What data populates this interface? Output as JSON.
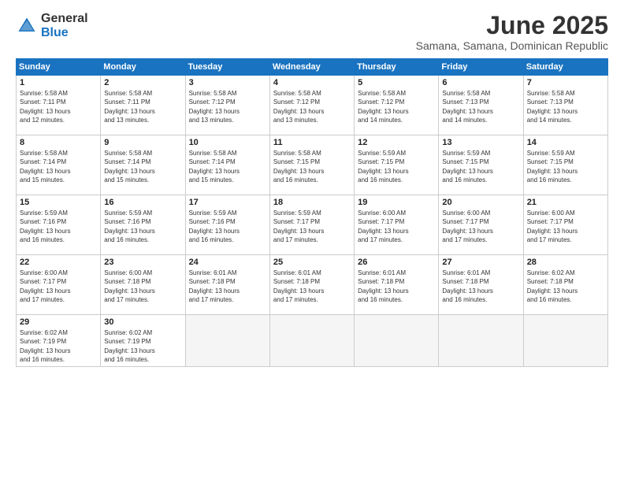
{
  "logo": {
    "general": "General",
    "blue": "Blue"
  },
  "title": "June 2025",
  "location": "Samana, Samana, Dominican Republic",
  "days_of_week": [
    "Sunday",
    "Monday",
    "Tuesday",
    "Wednesday",
    "Thursday",
    "Friday",
    "Saturday"
  ],
  "weeks": [
    [
      {
        "day": "1",
        "info": "Sunrise: 5:58 AM\nSunset: 7:11 PM\nDaylight: 13 hours\nand 12 minutes."
      },
      {
        "day": "2",
        "info": "Sunrise: 5:58 AM\nSunset: 7:11 PM\nDaylight: 13 hours\nand 13 minutes."
      },
      {
        "day": "3",
        "info": "Sunrise: 5:58 AM\nSunset: 7:12 PM\nDaylight: 13 hours\nand 13 minutes."
      },
      {
        "day": "4",
        "info": "Sunrise: 5:58 AM\nSunset: 7:12 PM\nDaylight: 13 hours\nand 13 minutes."
      },
      {
        "day": "5",
        "info": "Sunrise: 5:58 AM\nSunset: 7:12 PM\nDaylight: 13 hours\nand 14 minutes."
      },
      {
        "day": "6",
        "info": "Sunrise: 5:58 AM\nSunset: 7:13 PM\nDaylight: 13 hours\nand 14 minutes."
      },
      {
        "day": "7",
        "info": "Sunrise: 5:58 AM\nSunset: 7:13 PM\nDaylight: 13 hours\nand 14 minutes."
      }
    ],
    [
      {
        "day": "8",
        "info": "Sunrise: 5:58 AM\nSunset: 7:14 PM\nDaylight: 13 hours\nand 15 minutes."
      },
      {
        "day": "9",
        "info": "Sunrise: 5:58 AM\nSunset: 7:14 PM\nDaylight: 13 hours\nand 15 minutes."
      },
      {
        "day": "10",
        "info": "Sunrise: 5:58 AM\nSunset: 7:14 PM\nDaylight: 13 hours\nand 15 minutes."
      },
      {
        "day": "11",
        "info": "Sunrise: 5:58 AM\nSunset: 7:15 PM\nDaylight: 13 hours\nand 16 minutes."
      },
      {
        "day": "12",
        "info": "Sunrise: 5:59 AM\nSunset: 7:15 PM\nDaylight: 13 hours\nand 16 minutes."
      },
      {
        "day": "13",
        "info": "Sunrise: 5:59 AM\nSunset: 7:15 PM\nDaylight: 13 hours\nand 16 minutes."
      },
      {
        "day": "14",
        "info": "Sunrise: 5:59 AM\nSunset: 7:15 PM\nDaylight: 13 hours\nand 16 minutes."
      }
    ],
    [
      {
        "day": "15",
        "info": "Sunrise: 5:59 AM\nSunset: 7:16 PM\nDaylight: 13 hours\nand 16 minutes."
      },
      {
        "day": "16",
        "info": "Sunrise: 5:59 AM\nSunset: 7:16 PM\nDaylight: 13 hours\nand 16 minutes."
      },
      {
        "day": "17",
        "info": "Sunrise: 5:59 AM\nSunset: 7:16 PM\nDaylight: 13 hours\nand 16 minutes."
      },
      {
        "day": "18",
        "info": "Sunrise: 5:59 AM\nSunset: 7:17 PM\nDaylight: 13 hours\nand 17 minutes."
      },
      {
        "day": "19",
        "info": "Sunrise: 6:00 AM\nSunset: 7:17 PM\nDaylight: 13 hours\nand 17 minutes."
      },
      {
        "day": "20",
        "info": "Sunrise: 6:00 AM\nSunset: 7:17 PM\nDaylight: 13 hours\nand 17 minutes."
      },
      {
        "day": "21",
        "info": "Sunrise: 6:00 AM\nSunset: 7:17 PM\nDaylight: 13 hours\nand 17 minutes."
      }
    ],
    [
      {
        "day": "22",
        "info": "Sunrise: 6:00 AM\nSunset: 7:17 PM\nDaylight: 13 hours\nand 17 minutes."
      },
      {
        "day": "23",
        "info": "Sunrise: 6:00 AM\nSunset: 7:18 PM\nDaylight: 13 hours\nand 17 minutes."
      },
      {
        "day": "24",
        "info": "Sunrise: 6:01 AM\nSunset: 7:18 PM\nDaylight: 13 hours\nand 17 minutes."
      },
      {
        "day": "25",
        "info": "Sunrise: 6:01 AM\nSunset: 7:18 PM\nDaylight: 13 hours\nand 17 minutes."
      },
      {
        "day": "26",
        "info": "Sunrise: 6:01 AM\nSunset: 7:18 PM\nDaylight: 13 hours\nand 16 minutes."
      },
      {
        "day": "27",
        "info": "Sunrise: 6:01 AM\nSunset: 7:18 PM\nDaylight: 13 hours\nand 16 minutes."
      },
      {
        "day": "28",
        "info": "Sunrise: 6:02 AM\nSunset: 7:18 PM\nDaylight: 13 hours\nand 16 minutes."
      }
    ],
    [
      {
        "day": "29",
        "info": "Sunrise: 6:02 AM\nSunset: 7:19 PM\nDaylight: 13 hours\nand 16 minutes."
      },
      {
        "day": "30",
        "info": "Sunrise: 6:02 AM\nSunset: 7:19 PM\nDaylight: 13 hours\nand 16 minutes."
      },
      null,
      null,
      null,
      null,
      null
    ]
  ]
}
